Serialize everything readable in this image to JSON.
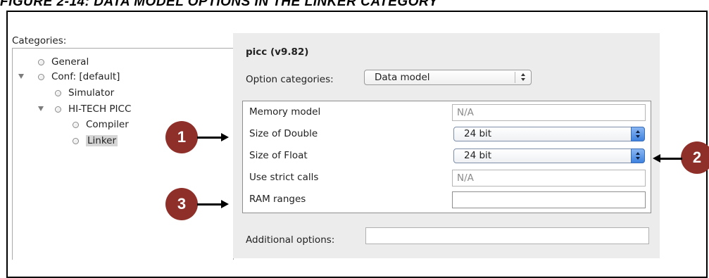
{
  "figure_title": "FIGURE 2-14:        DATA MODEL OPTIONS IN THE LINKER CATEGORY",
  "categories_label": "Categories:",
  "tree": [
    {
      "label": "General"
    },
    {
      "label": "Conf: [default]",
      "expanded": true
    },
    {
      "label": "Simulator"
    },
    {
      "label": "HI-TECH PICC",
      "expanded": true
    },
    {
      "label": "Compiler"
    },
    {
      "label": "Linker",
      "selected": true
    }
  ],
  "compiler_title": "picc (v9.82)",
  "option_categories": {
    "label": "Option categories:",
    "value": "Data model"
  },
  "options": [
    {
      "label": "Memory model",
      "value": "N/A",
      "type": "text"
    },
    {
      "label": "Size of Double",
      "value": "24 bit",
      "type": "select"
    },
    {
      "label": "Size of Float",
      "value": "24 bit",
      "type": "select"
    },
    {
      "label": "Use strict calls",
      "value": "N/A",
      "type": "text"
    },
    {
      "label": "RAM ranges",
      "value": "",
      "type": "text"
    }
  ],
  "additional_options": {
    "label": "Additional options:",
    "value": ""
  },
  "callouts": [
    "1",
    "2",
    "3"
  ],
  "colors": {
    "callout": "#8f2f2a",
    "select_button": "#3e82df",
    "panel": "#ececec"
  }
}
